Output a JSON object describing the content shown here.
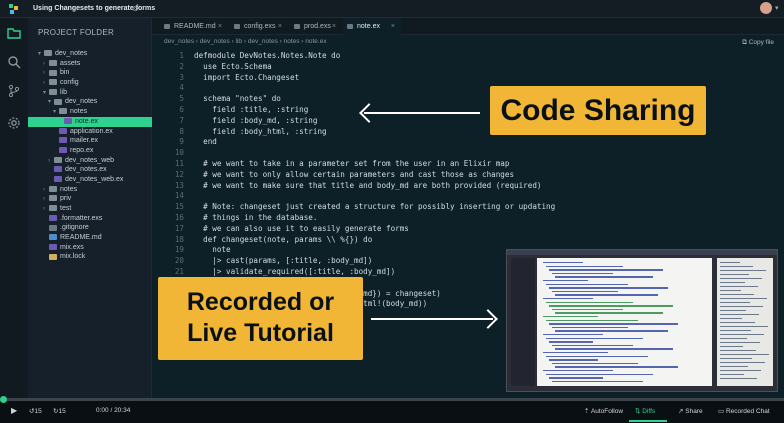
{
  "window": {
    "title": "Using Changesets to generate forms",
    "share_glyph": "⊚"
  },
  "sidebar": {
    "header": "PROJECT FOLDER",
    "tree": [
      {
        "label": "dev_notes",
        "depth": 0,
        "type": "folder",
        "chev": "▾"
      },
      {
        "label": "assets",
        "depth": 1,
        "type": "folder",
        "chev": "›"
      },
      {
        "label": "bin",
        "depth": 1,
        "type": "folder",
        "chev": "›"
      },
      {
        "label": "config",
        "depth": 1,
        "type": "folder",
        "chev": "›"
      },
      {
        "label": "lib",
        "depth": 1,
        "type": "folder",
        "chev": "▾"
      },
      {
        "label": "dev_notes",
        "depth": 2,
        "type": "folder",
        "chev": "▾"
      },
      {
        "label": "notes",
        "depth": 3,
        "type": "folder",
        "chev": "▾"
      },
      {
        "label": "note.ex",
        "depth": 4,
        "type": "ex",
        "chev": "",
        "active": true
      },
      {
        "label": "application.ex",
        "depth": 3,
        "type": "ex",
        "chev": ""
      },
      {
        "label": "mailer.ex",
        "depth": 3,
        "type": "ex",
        "chev": ""
      },
      {
        "label": "repo.ex",
        "depth": 3,
        "type": "ex",
        "chev": ""
      },
      {
        "label": "dev_notes_web",
        "depth": 2,
        "type": "folder",
        "chev": "›"
      },
      {
        "label": "dev_notes.ex",
        "depth": 2,
        "type": "ex",
        "chev": ""
      },
      {
        "label": "dev_notes_web.ex",
        "depth": 2,
        "type": "ex",
        "chev": ""
      },
      {
        "label": "notes",
        "depth": 1,
        "type": "folder",
        "chev": "›"
      },
      {
        "label": "priv",
        "depth": 1,
        "type": "folder",
        "chev": "›"
      },
      {
        "label": "test",
        "depth": 1,
        "type": "folder",
        "chev": "›"
      },
      {
        "label": ".formatter.exs",
        "depth": 1,
        "type": "ex",
        "chev": ""
      },
      {
        "label": ".gitignore",
        "depth": 1,
        "type": "file",
        "chev": ""
      },
      {
        "label": "README.md",
        "depth": 1,
        "type": "md",
        "chev": ""
      },
      {
        "label": "mix.exs",
        "depth": 1,
        "type": "ex",
        "chev": ""
      },
      {
        "label": "mix.lock",
        "depth": 1,
        "type": "lock",
        "chev": ""
      }
    ]
  },
  "tabs": [
    {
      "label": "README.md",
      "close": "×",
      "active": false
    },
    {
      "label": "config.exs",
      "close": "×",
      "active": false
    },
    {
      "label": "prod.exs",
      "close": "×",
      "active": false
    },
    {
      "label": "note.ex",
      "close": "×",
      "active": true
    }
  ],
  "breadcrumb": "dev_notes  ›  dev_notes  ›  lib  ›  dev_notes  ›  notes  ›  note.ex",
  "copy_label": "Copy file",
  "code_lines": [
    {
      "n": "1",
      "t": "defmodule DevNotes.Notes.Note do",
      "c": "kw"
    },
    {
      "n": "2",
      "t": "  use Ecto.Schema",
      "c": "kw"
    },
    {
      "n": "3",
      "t": "  import Ecto.Changeset",
      "c": "kw"
    },
    {
      "n": "4",
      "t": "",
      "c": ""
    },
    {
      "n": "5",
      "t": "  schema \"notes\" do",
      "c": "str"
    },
    {
      "n": "6",
      "t": "    field :title, :string",
      "c": ""
    },
    {
      "n": "7",
      "t": "    field :body_md, :string",
      "c": ""
    },
    {
      "n": "8",
      "t": "    field :body_html, :string",
      "c": ""
    },
    {
      "n": "9",
      "t": "  end",
      "c": "kw"
    },
    {
      "n": "10",
      "t": "",
      "c": ""
    },
    {
      "n": "11",
      "t": "  # we want to take in a parameter set from the user in an Elixir map",
      "c": "com"
    },
    {
      "n": "12",
      "t": "  # we want to only allow certain parameters and cast those as changes",
      "c": "com"
    },
    {
      "n": "13",
      "t": "  # we want to make sure that title and body_md are both provided (required)",
      "c": "com"
    },
    {
      "n": "14",
      "t": "",
      "c": ""
    },
    {
      "n": "15",
      "t": "  # Note: changeset just created a structure for possibly inserting or updating",
      "c": "com"
    },
    {
      "n": "16",
      "t": "  # things in the database.",
      "c": "com"
    },
    {
      "n": "17",
      "t": "  # we can also use it to easily generate forms",
      "c": "com"
    },
    {
      "n": "18",
      "t": "  def changeset(note, params \\\\ %{}) do",
      "c": "kw"
    },
    {
      "n": "19",
      "t": "    note",
      "c": ""
    },
    {
      "n": "20",
      "t": "    |> cast(params, [:title, :body_md])",
      "c": ""
    },
    {
      "n": "21",
      "t": "    |> validate_required([:title, :body_md])",
      "c": ""
    },
    {
      "n": "",
      "t": "",
      "c": ""
    },
    {
      "n": "",
      "t": "                         dy_md: body_md}) = changeset)",
      "c": ""
    },
    {
      "n": "",
      "t": "                         Earmark.as_html!(body_md))",
      "c": ""
    },
    {
      "n": "",
      "t": "",
      "c": ""
    },
    {
      "n": "",
      "t": "                         changeset",
      "c": ""
    }
  ],
  "callouts": {
    "code_sharing": "Code Sharing",
    "recorded_line1": "Recorded or",
    "recorded_line2": "Live Tutorial"
  },
  "player": {
    "progress": 0.0,
    "play_icon": "▶",
    "rewind": "15",
    "forward": "15",
    "time": "0:00 / 20:34",
    "autofollow": "AutoFollow",
    "diffs": "Diffs",
    "share": "Share",
    "recorded_chat": "Recorded Chat"
  },
  "colors": {
    "accent": "#2fd18f",
    "callout": "#f2b636",
    "background": "#0d1f27"
  }
}
